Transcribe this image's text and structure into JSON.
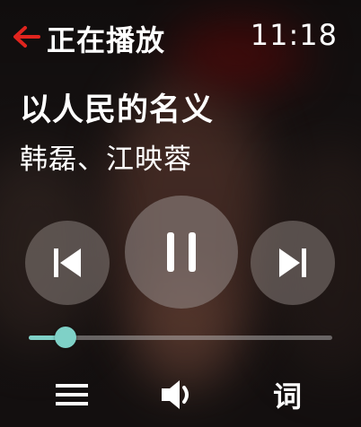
{
  "header": {
    "title": "正在播放",
    "time": "11:18",
    "back_icon": "back-arrow-icon",
    "accent_color": "#e0241e"
  },
  "track": {
    "title": "以人民的名义",
    "artist": "韩磊、江映蓉"
  },
  "controls": {
    "prev_icon": "skip-previous-icon",
    "pause_icon": "pause-icon",
    "next_icon": "skip-next-icon"
  },
  "progress": {
    "fraction": 0.12,
    "color": "#7fd1c7"
  },
  "bottom_bar": {
    "playlist_icon": "playlist-menu-icon",
    "volume_icon": "volume-icon",
    "lyrics_label": "词"
  }
}
